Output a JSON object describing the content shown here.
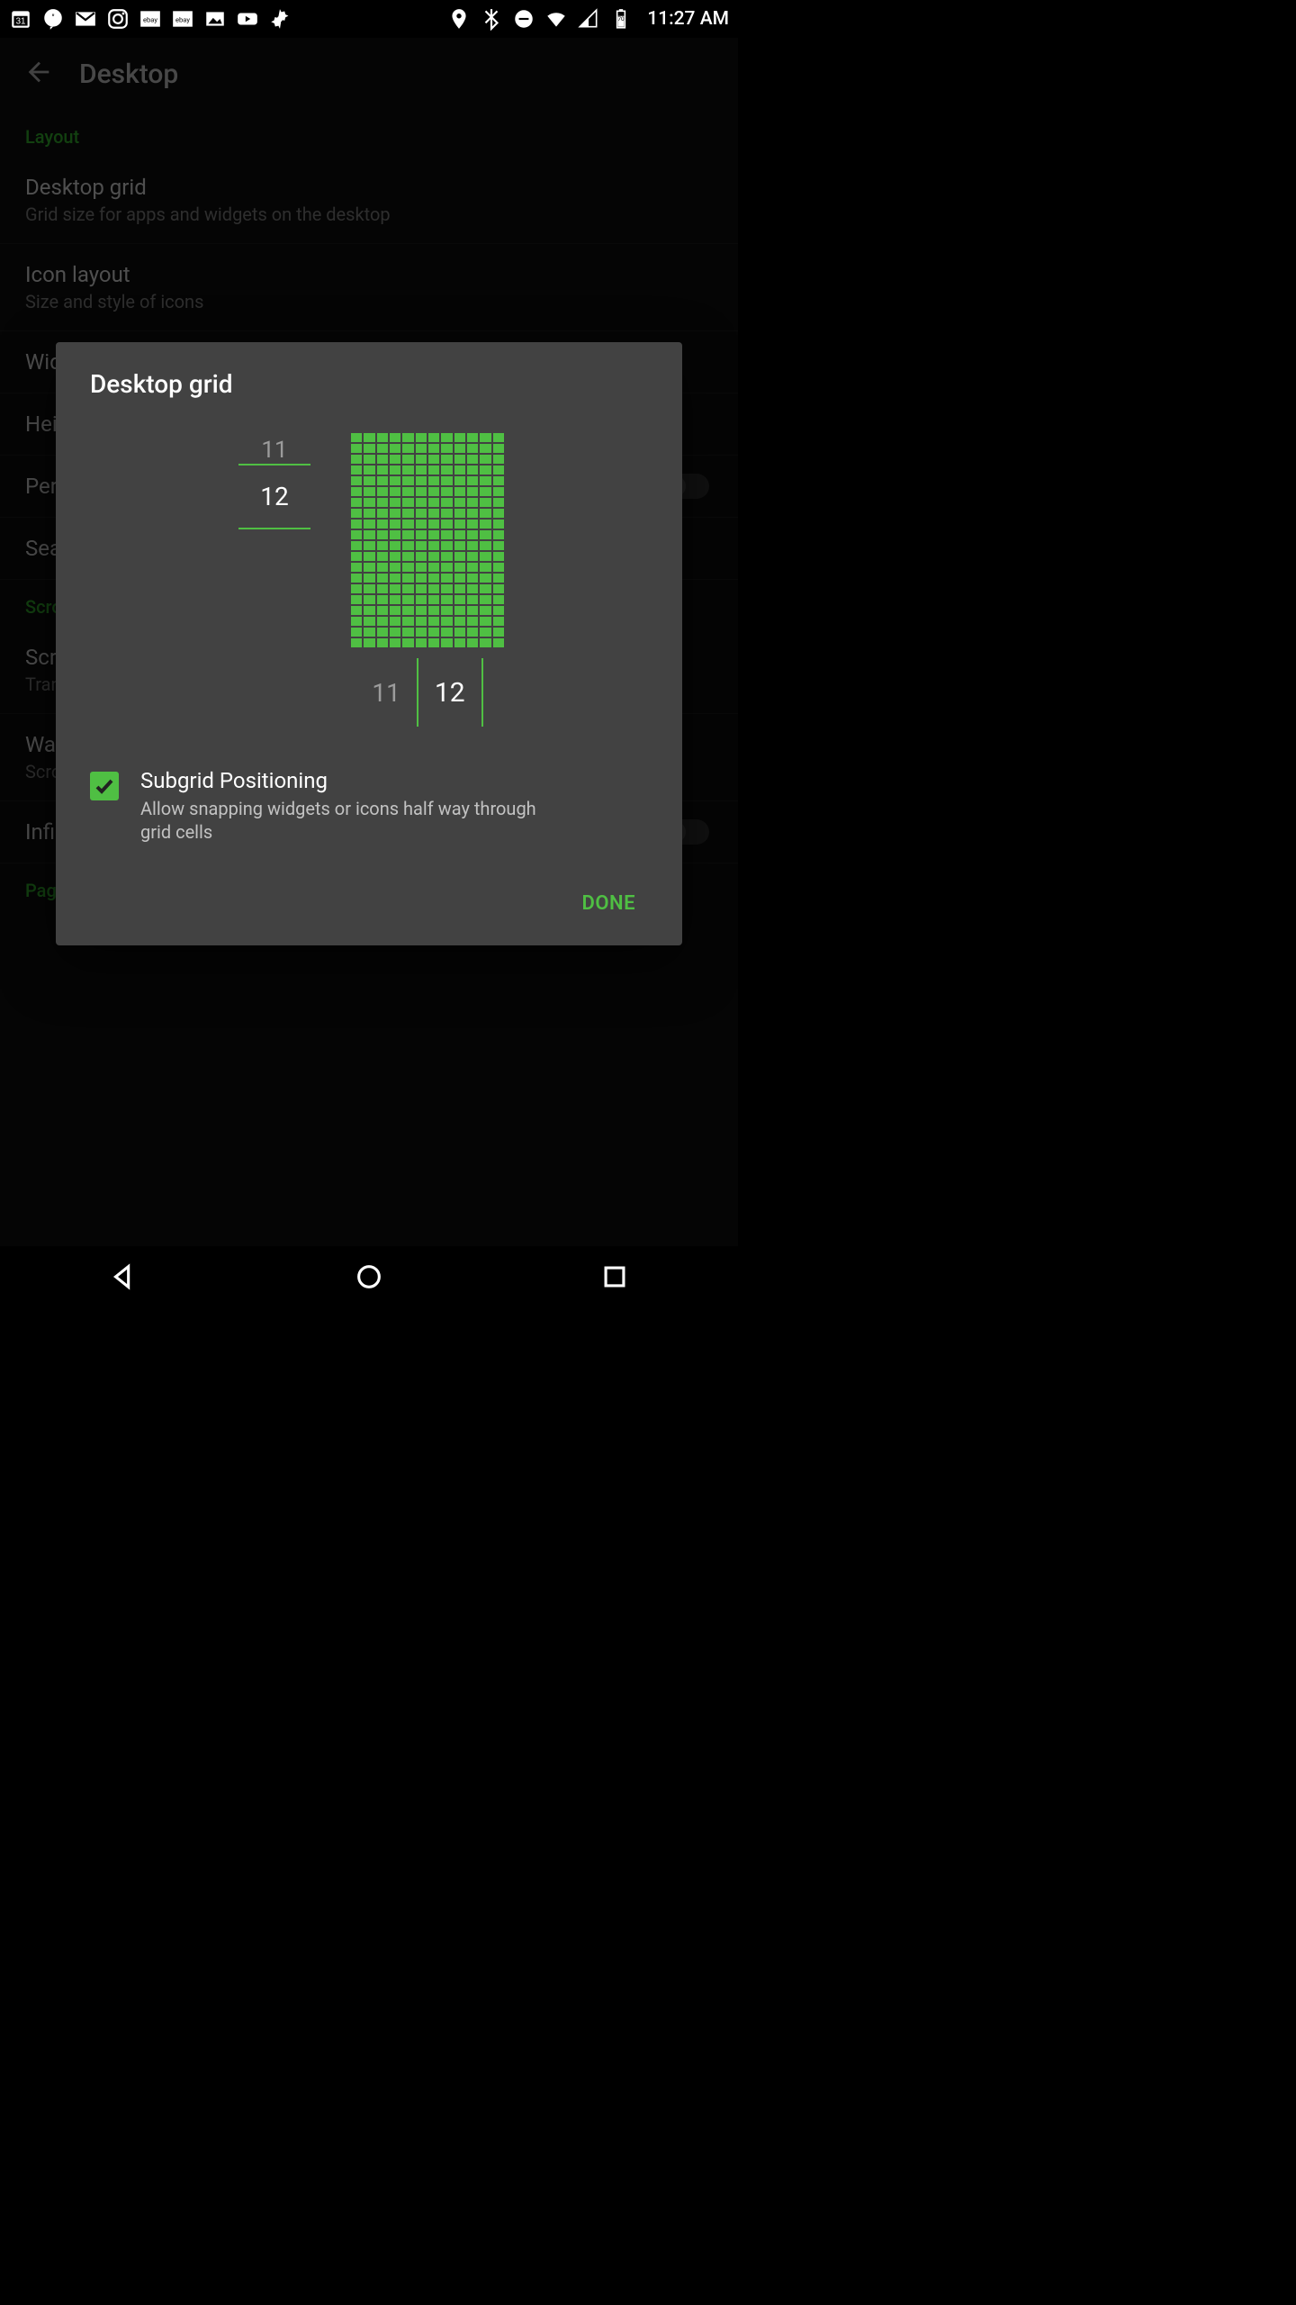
{
  "status": {
    "time": "11:27 AM"
  },
  "appbar": {
    "title": "Desktop"
  },
  "bg": {
    "section1": "Layout",
    "items": [
      {
        "t": "Desktop grid",
        "s": "Grid size for apps and widgets on the desktop"
      },
      {
        "t": "Icon layout",
        "s": "Size and style of icons"
      },
      {
        "t": "Width padding",
        "s": ""
      },
      {
        "t": "Height padding",
        "s": ""
      },
      {
        "t": "Persistent search bar",
        "s": ""
      },
      {
        "t": "Search bar style",
        "s": ""
      }
    ],
    "section2": "Scrolling",
    "items2": [
      {
        "t": "Scroll effect",
        "s": "Transition effect when scrolling"
      },
      {
        "t": "Wallpaper scrolling",
        "s": "Scroll wallpaper when scrolling homescreens"
      },
      {
        "t": "Infinite scroll",
        "s": ""
      }
    ],
    "section3": "Page indicator"
  },
  "dialog": {
    "title": "Desktop grid",
    "rows_prev": "11",
    "rows": "12",
    "cols_prev": "11",
    "cols": "12",
    "grid_rows": 20,
    "grid_cols": 12,
    "subgrid_title": "Subgrid Positioning",
    "subgrid_sub": "Allow snapping widgets or icons half way through grid cells",
    "subgrid_checked": true,
    "done": "DONE"
  }
}
